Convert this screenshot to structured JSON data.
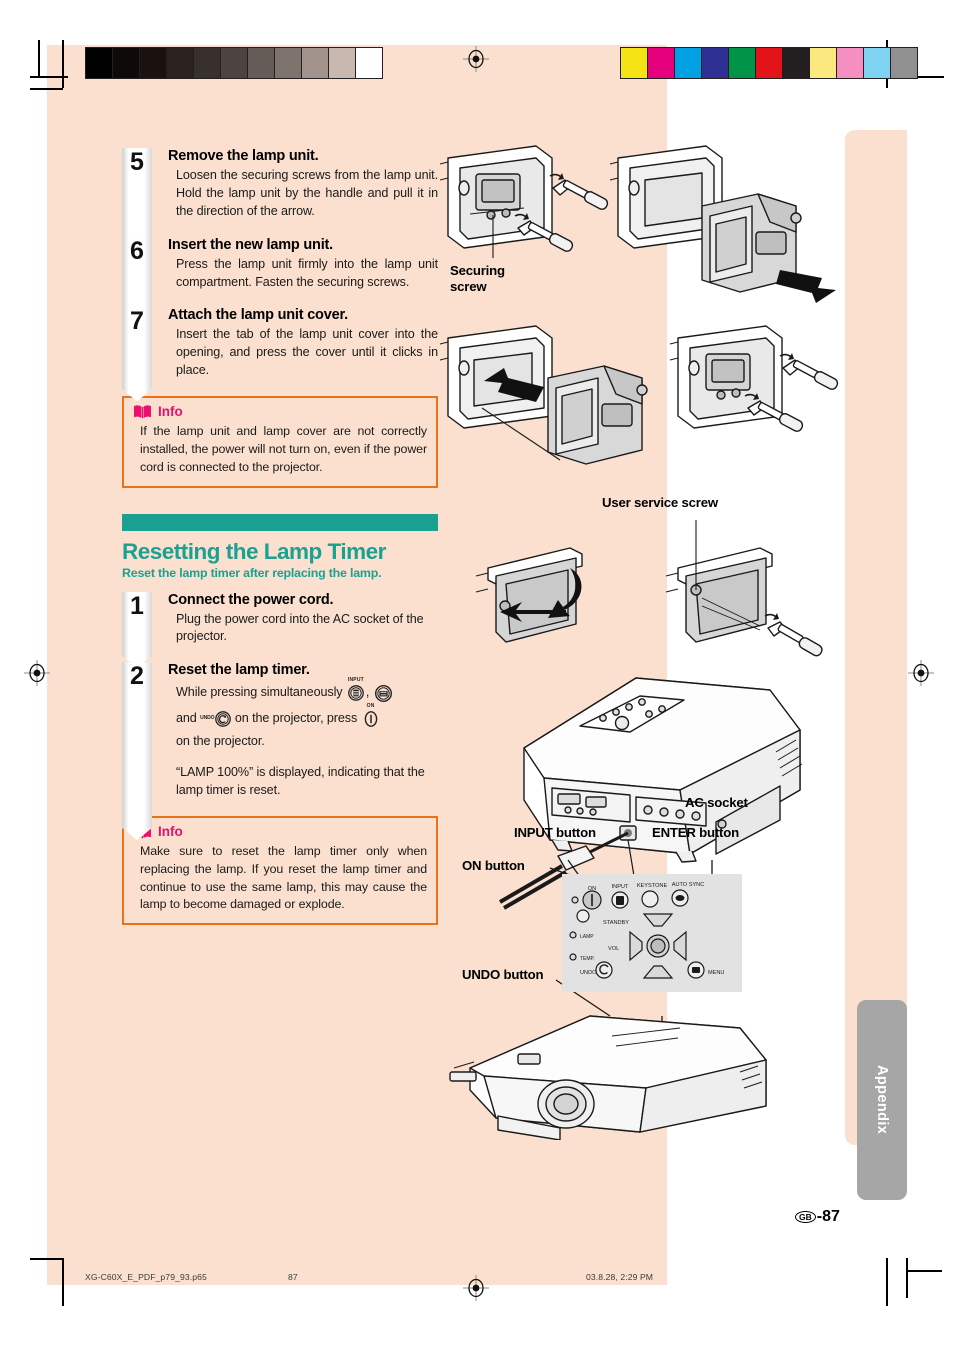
{
  "page": {
    "number_prefix": "GB",
    "number": "-87",
    "side_tab": "Appendix"
  },
  "steps": [
    {
      "num": "5",
      "title": "Remove the lamp unit.",
      "body": "Loosen the securing screws from the lamp unit. Hold the lamp unit by the handle and pull it in the direction of the arrow."
    },
    {
      "num": "6",
      "title": "Insert the new lamp unit.",
      "body": "Press the lamp unit firmly into the lamp unit compartment. Fasten the securing screws."
    },
    {
      "num": "7",
      "title": "Attach the lamp unit cover.",
      "body": "Insert the tab of the lamp unit cover into the opening, and press the cover until it clicks in place."
    }
  ],
  "info_top": {
    "label": "Info",
    "text": "If the lamp unit and lamp cover are not correctly installed, the power will not turn on, even if the power cord is connected to the projector."
  },
  "section": {
    "title": "Resetting the Lamp Timer",
    "subtitle": "Reset the lamp timer after replacing the lamp."
  },
  "reset_steps": [
    {
      "num": "1",
      "title": "Connect the power cord.",
      "body": "Plug the power cord into the AC socket of the projector."
    },
    {
      "num": "2",
      "title": "Reset the lamp timer.",
      "body_part1": "While pressing simultaneously",
      "body_part2": "and",
      "body_part3": "on the projector, press",
      "body_part4": "on the projector.",
      "body2": "“LAMP 100%” is displayed, indicating that the lamp timer is reset.",
      "key_input_cap": "INPUT",
      "key_undo_cap": "UNDO",
      "key_on_cap": "ON"
    }
  ],
  "info_bottom": {
    "label": "Info",
    "text": "Make sure to reset the lamp timer only when replacing the lamp. If you reset the lamp timer and continue to use the same lamp, this may cause the lamp to become damaged or explode."
  },
  "art_labels": {
    "securing_screw": "Securing\nscrew",
    "securing_screw_line1": "Securing",
    "securing_screw_line2": "screw",
    "user_service_screw": "User service screw",
    "ac_socket": "AC socket",
    "input_button": "INPUT button",
    "enter_button": "ENTER button",
    "on_button": "ON button",
    "undo_button": "UNDO button"
  },
  "panel_legends": {
    "on": "ON",
    "standby": "STANDBY",
    "input": "INPUT",
    "keystone": "KEYSTONE",
    "auto_sync": "AUTO SYNC",
    "lamp": "LAMP",
    "temp": "TEMP.",
    "vol": "VOL",
    "undo": "UNDO",
    "menu": "MENU"
  },
  "footer": {
    "filename": "XG-C60X_E_PDF_p79_93.p65",
    "page": "87",
    "timestamp": "03.8.28, 2:29 PM"
  },
  "colors": {
    "peach": "#fbe0cf",
    "teal": "#1aa192",
    "info_border": "#e8731a",
    "info_label": "#ec0e6e",
    "side_tab": "#a6a6a6"
  },
  "swatches_gray": [
    "#000000",
    "#0d0a09",
    "#19120f",
    "#2b2320",
    "#37302c",
    "#4b4440",
    "#655b57",
    "#7f736e",
    "#a2938c",
    "#c8b8b0",
    "#ffffff"
  ],
  "swatches_color": [
    "#f5e314",
    "#e6007e",
    "#00a0e3",
    "#2e3192",
    "#009448",
    "#e3131a",
    "#231f20",
    "#fbe97f",
    "#f58fc2",
    "#7fd3f2",
    "#909090"
  ]
}
